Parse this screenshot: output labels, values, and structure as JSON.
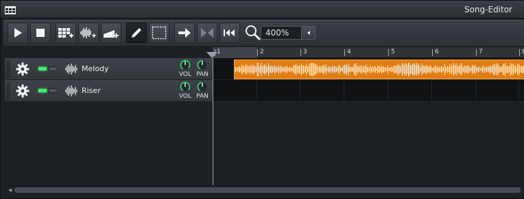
{
  "window": {
    "title": "Song-Editor"
  },
  "toolbar": {
    "buttons": [
      "play-icon",
      "stop-icon",
      "add-beat-bassline-icon",
      "add-sample-track-icon",
      "add-automation-track-icon",
      "draw-mode-icon",
      "edit-mode-icon",
      "move-right-icon",
      "loop-points-icon",
      "rewind-to-start-icon"
    ],
    "zoom_value": "400%"
  },
  "timeline": {
    "bars": [
      "1",
      "2",
      "3",
      "4",
      "5",
      "6",
      "7",
      "8"
    ]
  },
  "tracks": [
    {
      "name": "Melody",
      "vol_label": "VOL",
      "pan_label": "PAN",
      "has_clip": true
    },
    {
      "name": "Riser",
      "vol_label": "VOL",
      "pan_label": "PAN",
      "has_clip": false
    }
  ],
  "colors": {
    "clip": "#e07d12",
    "led_on": "#3cf06a",
    "knob_arc": "#2fd46a"
  }
}
